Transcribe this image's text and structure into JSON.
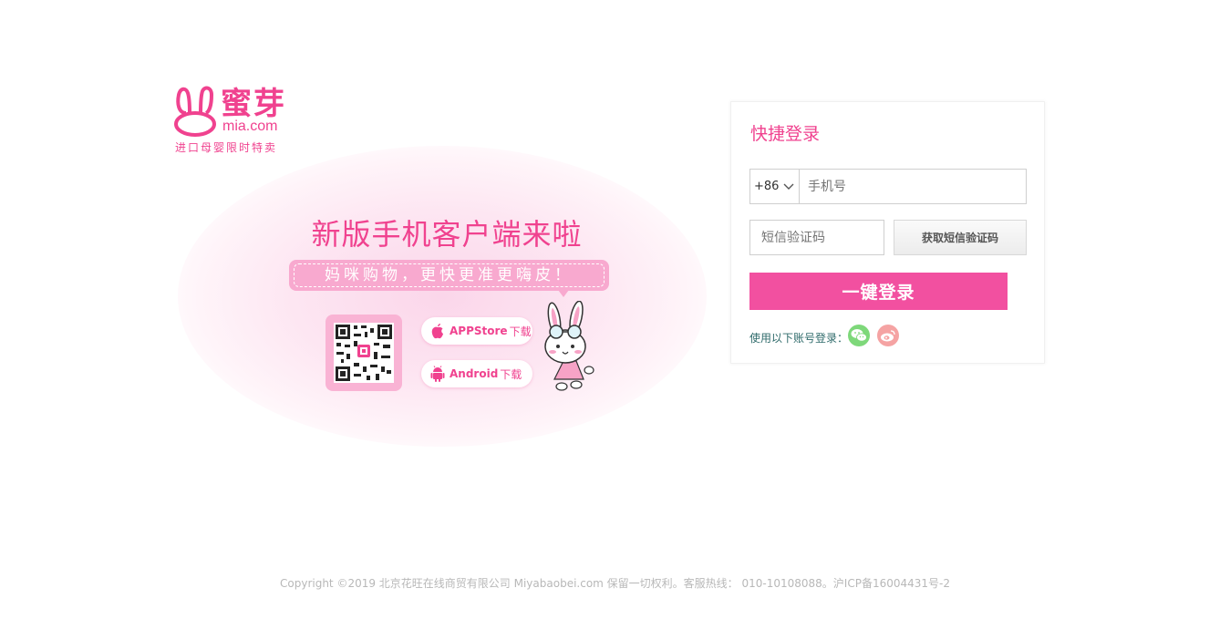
{
  "logo": {
    "name_cn": "蜜芽",
    "name_en": "mia.com",
    "tagline": "进口母婴限时特卖"
  },
  "promo": {
    "title": "新版手机客户端来啦",
    "subtitle": "妈咪购物，更快更准更嗨皮！",
    "appstore": {
      "label": "APPStore",
      "suffix": "下载"
    },
    "android": {
      "label": "Android",
      "suffix": "下载"
    }
  },
  "login": {
    "title": "快捷登录",
    "country_code": "+86",
    "phone_placeholder": "手机号",
    "sms_placeholder": "短信验证码",
    "sms_button": "获取短信验证码",
    "submit": "一键登录",
    "social_label": "使用以下账号登录："
  },
  "footer": {
    "text": "Copyright ©2019 北京花旺在线商贸有限公司 Miyabaobei.com 保留一切权利。客服热线： 010-10108088。沪ICP备16004431号-2"
  },
  "colors": {
    "brand": "#f0428f",
    "button": "#f250a0"
  }
}
